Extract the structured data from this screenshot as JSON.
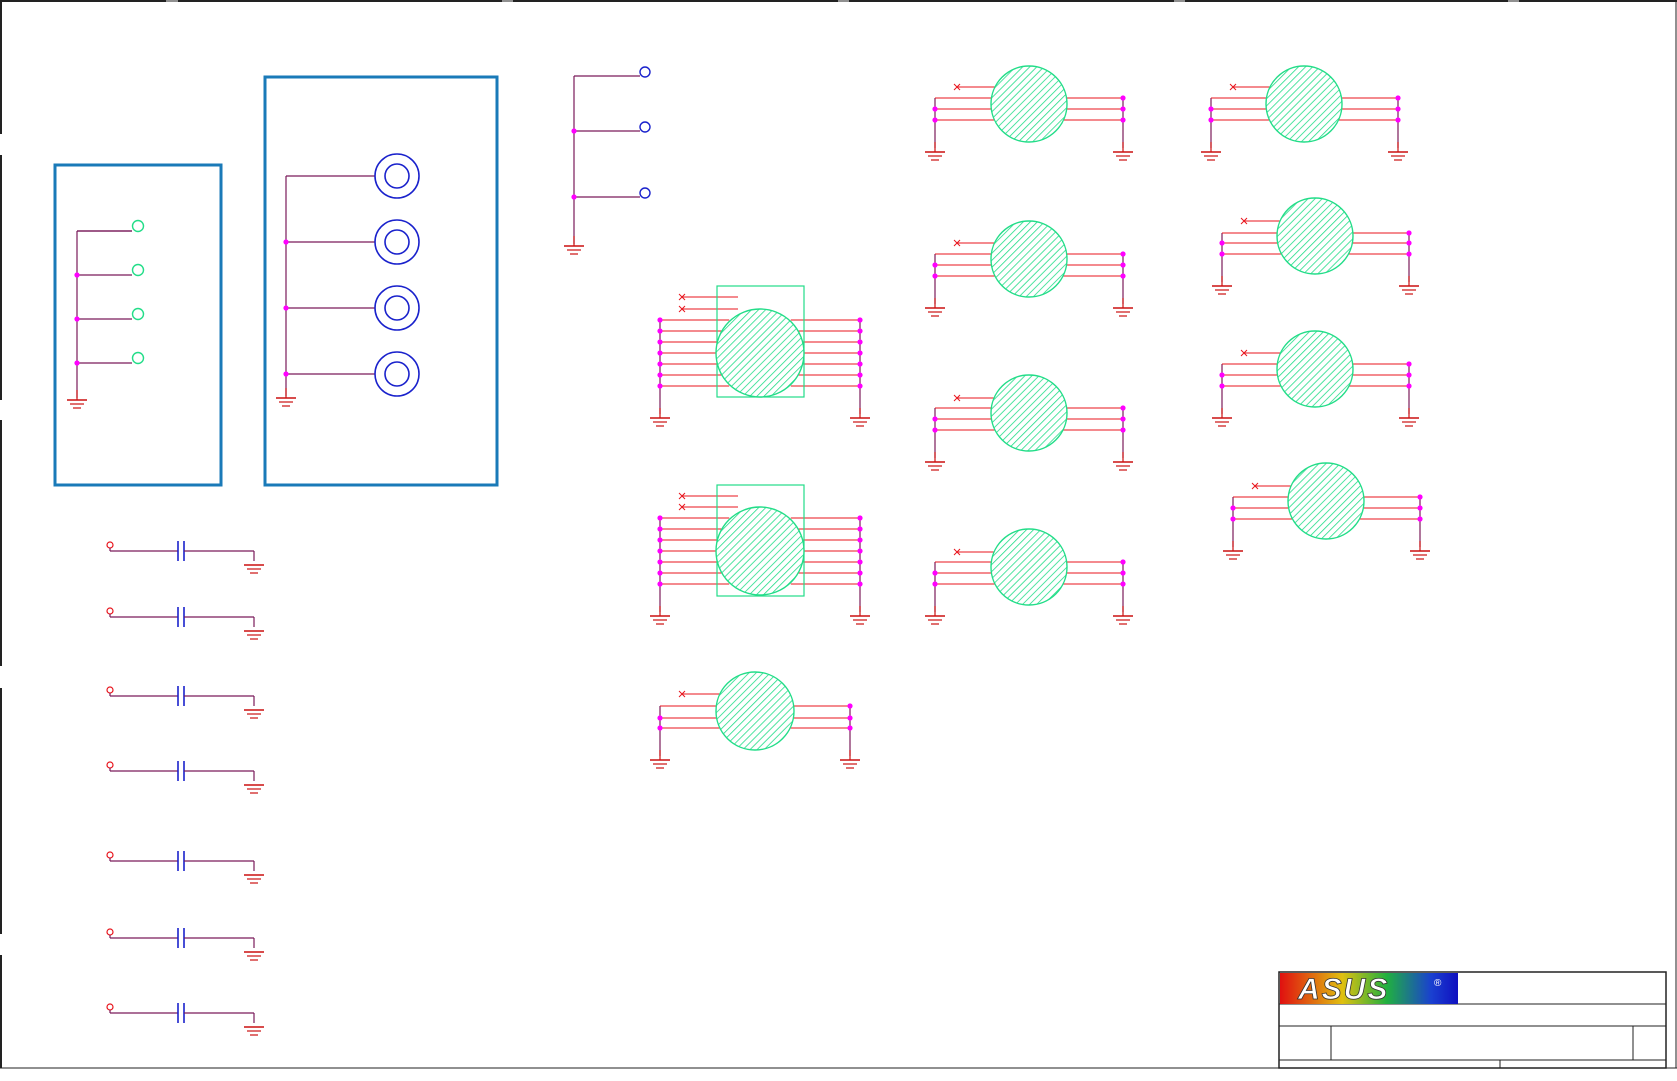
{
  "title_block": {
    "logo": "ASUS",
    "logo_mark": "®"
  },
  "colors": {
    "wire_red": "#e8141c",
    "wire_purple": "#7a1a5a",
    "junction": "#ff00ff",
    "component_green": "#22dd88",
    "pad_blue": "#1a22cc",
    "box_blue": "#1a7ab8",
    "ground": "#cc1111",
    "border": "#222222"
  },
  "icons": {
    "mount_hole": "double-circle",
    "test_point": "small-circle",
    "ground_symbol": "ground-icon",
    "capacitor_symbol": "capacitor-icon",
    "shield_can": "hatched-circle"
  }
}
